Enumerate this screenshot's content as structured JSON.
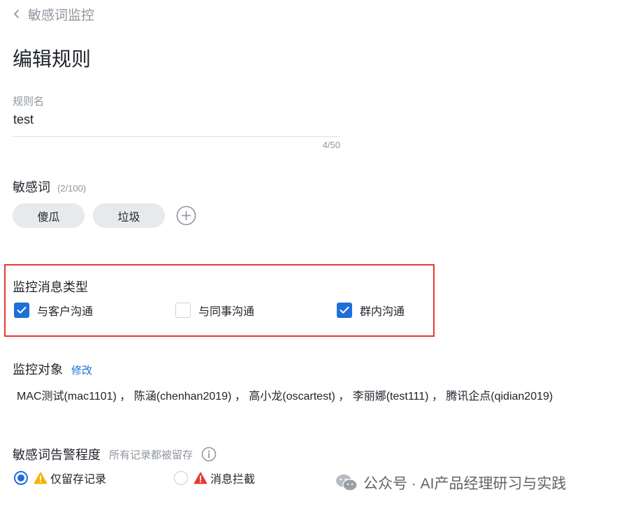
{
  "nav": {
    "back_label": "敏感词监控"
  },
  "page": {
    "title": "编辑规则"
  },
  "rule_name": {
    "label": "规则名",
    "value": "test",
    "counter": "4/50"
  },
  "sensitive_words": {
    "label": "敏感词",
    "count": "(2/100)",
    "tags": [
      "傻瓜",
      "垃圾"
    ]
  },
  "message_types": {
    "title": "监控消息类型",
    "options": [
      {
        "label": "与客户沟通",
        "checked": true
      },
      {
        "label": "与同事沟通",
        "checked": false
      },
      {
        "label": "群内沟通",
        "checked": true
      }
    ]
  },
  "monitor_targets": {
    "title": "监控对象",
    "edit_label": "修改",
    "list_text": "MAC测试(mac1101) ，  陈涵(chenhan2019) ，  高小龙(oscartest) ，  李丽娜(test111) ，  腾讯企点(qidian2019)"
  },
  "alert_level": {
    "title": "敏感词告警程度",
    "hint": "所有记录都被留存",
    "options": [
      {
        "label": "仅留存记录",
        "selected": true,
        "icon": "warning-yellow-icon",
        "color": "#f5b100"
      },
      {
        "label": "消息拦截",
        "selected": false,
        "icon": "warning-red-icon",
        "color": "#e53935"
      }
    ]
  },
  "watermark": {
    "text": "公众号 · AI产品经理研习与实践"
  },
  "colors": {
    "accent": "#1e6fd9",
    "highlight_border": "#e53935",
    "tag_bg": "#e8e9eb",
    "muted_text": "#8f959e"
  }
}
